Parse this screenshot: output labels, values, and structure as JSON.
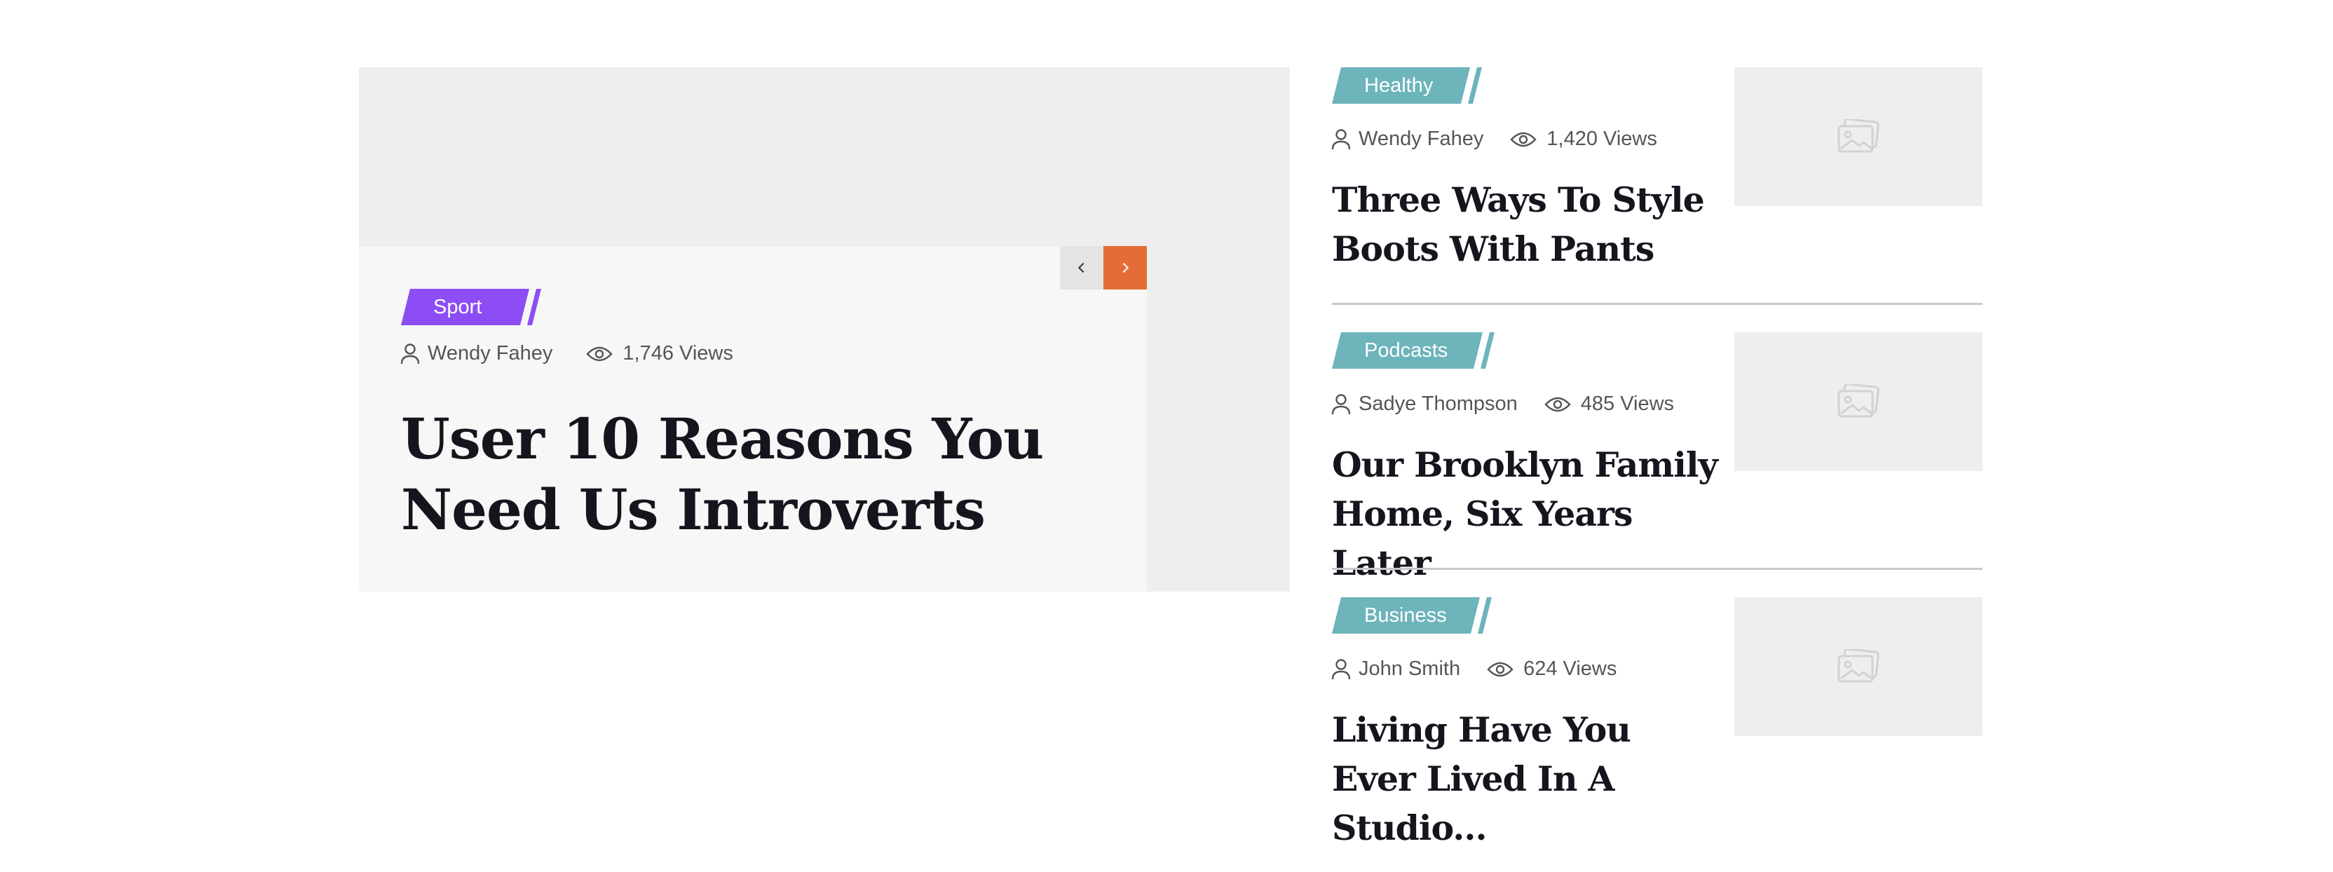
{
  "featured": {
    "category": "Sport",
    "author": "Wendy Fahey",
    "views": "1,746 Views",
    "title": "User 10 Reasons You Need Us Introverts",
    "nav_prev_icon": "chevron-left-icon",
    "nav_next_icon": "chevron-right-icon"
  },
  "posts": [
    {
      "category": "Healthy",
      "author": "Wendy Fahey",
      "views": "1,420 Views",
      "title": "Three Ways To Style Boots With Pants",
      "thumb_icon": "image-placeholder-icon"
    },
    {
      "category": "Podcasts",
      "author": "Sadye Thompson",
      "views": "485 Views",
      "title": "Our Brooklyn Family Home, Six Years Later",
      "thumb_icon": "image-placeholder-icon"
    },
    {
      "category": "Business",
      "author": "John Smith",
      "views": "624 Views",
      "title": "Living Have You Ever Lived In A Studio...",
      "thumb_icon": "image-placeholder-icon"
    }
  ],
  "colors": {
    "sport_tag": "#8d4df4",
    "category_tag": "#6db4bb",
    "nav_next": "#e46d37",
    "title_text": "#15151e"
  }
}
